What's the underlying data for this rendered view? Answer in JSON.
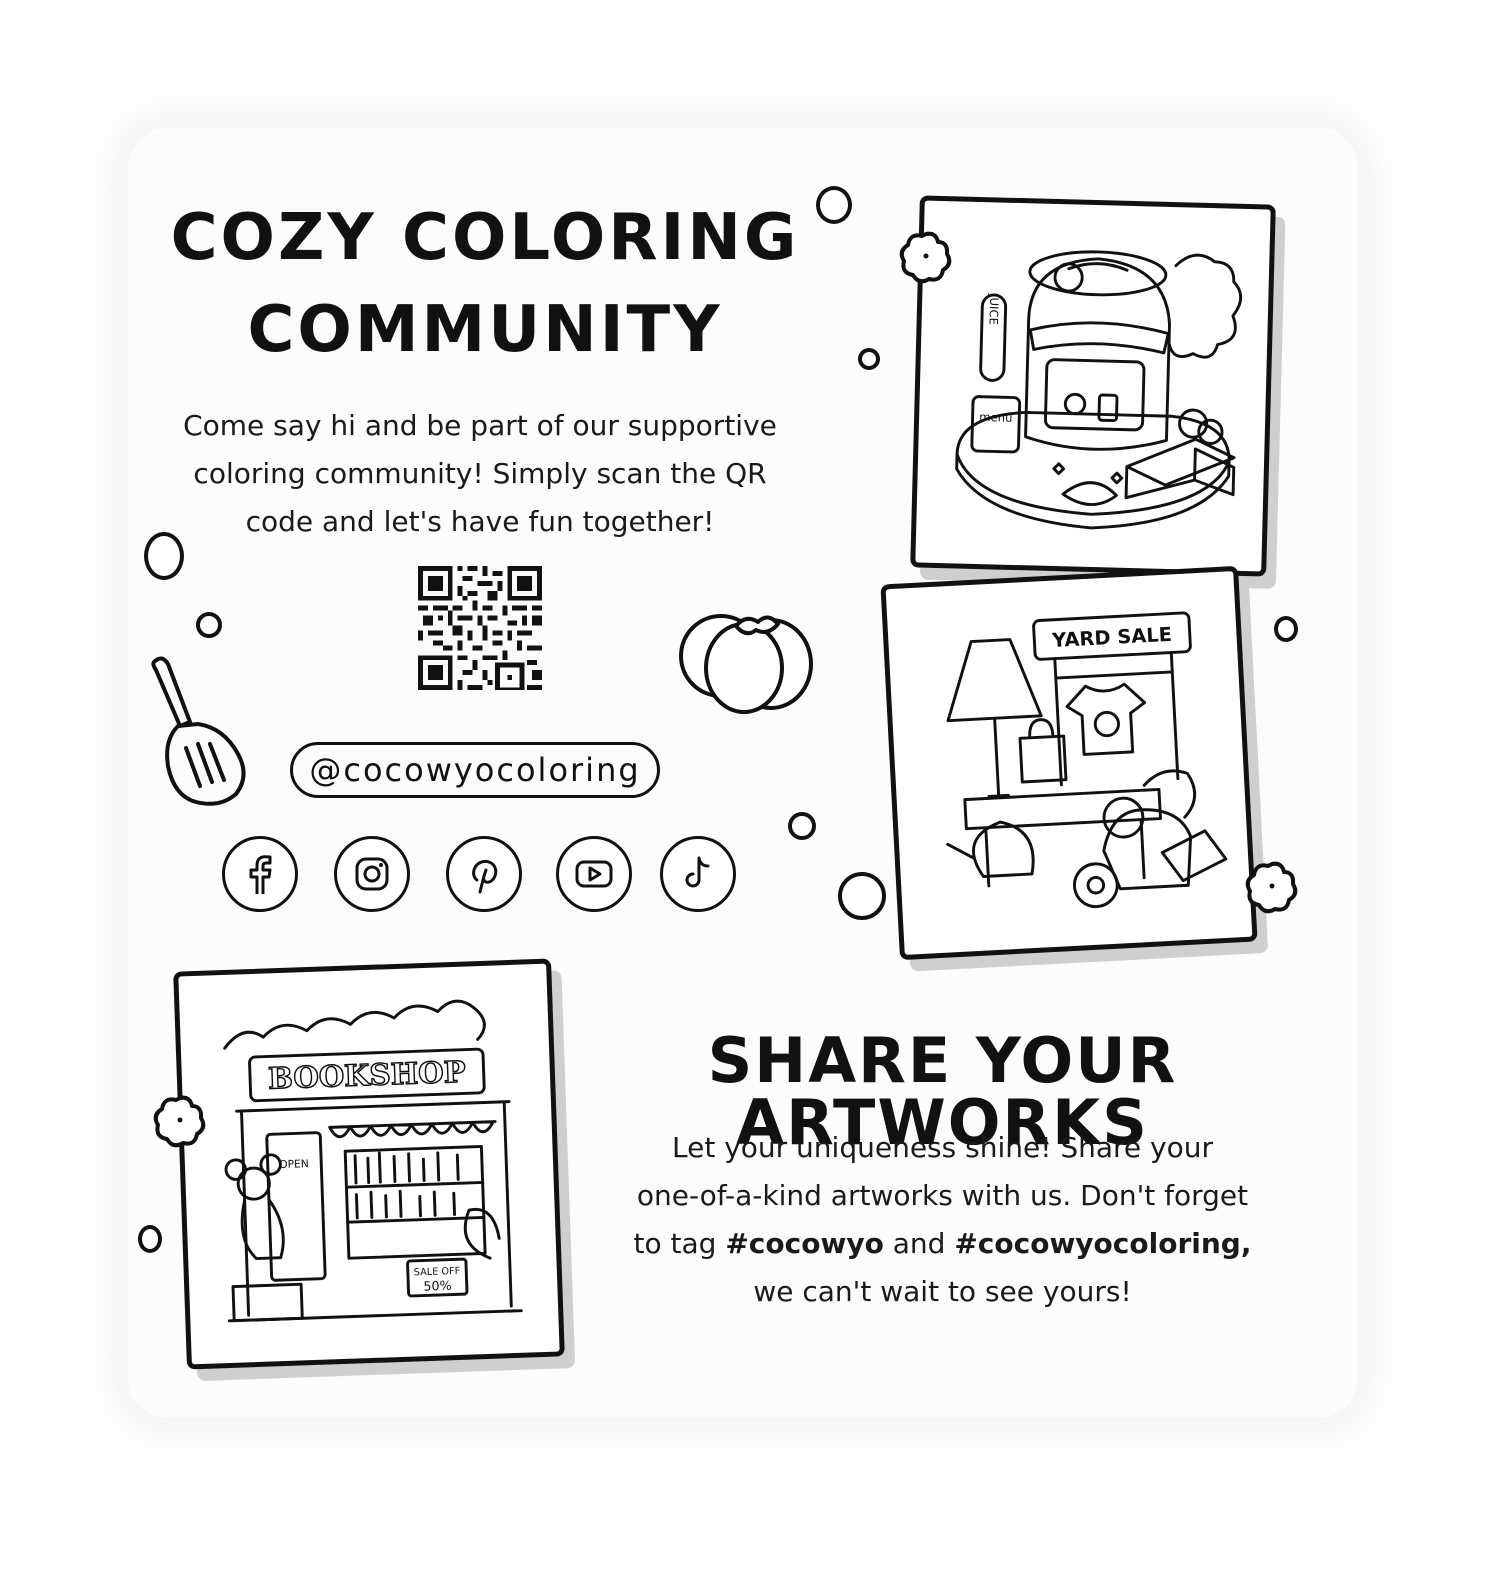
{
  "community": {
    "title_line1": "COZY COLORING",
    "title_line2": "COMMUNITY",
    "intro_line1": "Come say hi and be part of our supportive",
    "intro_line2": "coloring community! Simply scan the QR",
    "intro_line3": "code and let's have fun together!",
    "handle": "@cocowyocoloring",
    "socials": [
      "facebook-icon",
      "instagram-icon",
      "pinterest-icon",
      "youtube-icon",
      "tiktok-icon"
    ]
  },
  "share": {
    "title": "SHARE YOUR ARTWORKS",
    "line1": "Let your uniqueness shine! Share your",
    "line2": "one-of-a-kind artworks with us. Don't forget",
    "line3_prefix": "to tag",
    "hashtag1": "#cocowyo",
    "line3_mid": "and",
    "hashtag2": "#cocowyocoloring,",
    "line4": "we can't wait to see yours!"
  },
  "illustrations": {
    "juice_sign": "JUICE",
    "juice_menu": "menu",
    "yard_sale_sign": "YARD SALE",
    "bookshop_sign": "BOOKSHOP",
    "bookshop_open": "OPEN",
    "bookshop_sale": "SALE OFF",
    "bookshop_sale_pct": "50%"
  },
  "colors": {
    "ink": "#111111",
    "paper": "#ffffff",
    "shadow": "#cfcfcf"
  }
}
